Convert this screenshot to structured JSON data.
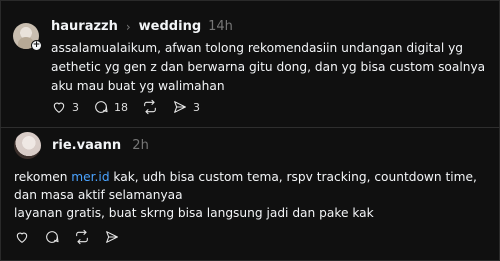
{
  "post1": {
    "username": "haurazzh",
    "topic": "wedding",
    "time": "14h",
    "text": "assalamualaikum, afwan tolong rekomendasiin undangan digital yg aethetic yg gen z dan berwarna gitu dong, dan yg bisa custom soalnya aku mau buat yg walimahan",
    "likes": "3",
    "replies": "18",
    "shares": "3"
  },
  "post2": {
    "username": "rie.vaann",
    "time": "2h",
    "text_before_link": "rekomen ",
    "link": "mer.id",
    "text_after_link": " kak, udh bisa custom tema, rspv tracking, countdown time, dan masa aktif selamanyaa",
    "text_line2": "layanan gratis, buat skrng bisa langsung jadi dan pake kak"
  },
  "icons": [
    "heart-icon",
    "comment-icon",
    "repost-icon",
    "share-icon",
    "plus-icon",
    "chevron-right-icon"
  ]
}
